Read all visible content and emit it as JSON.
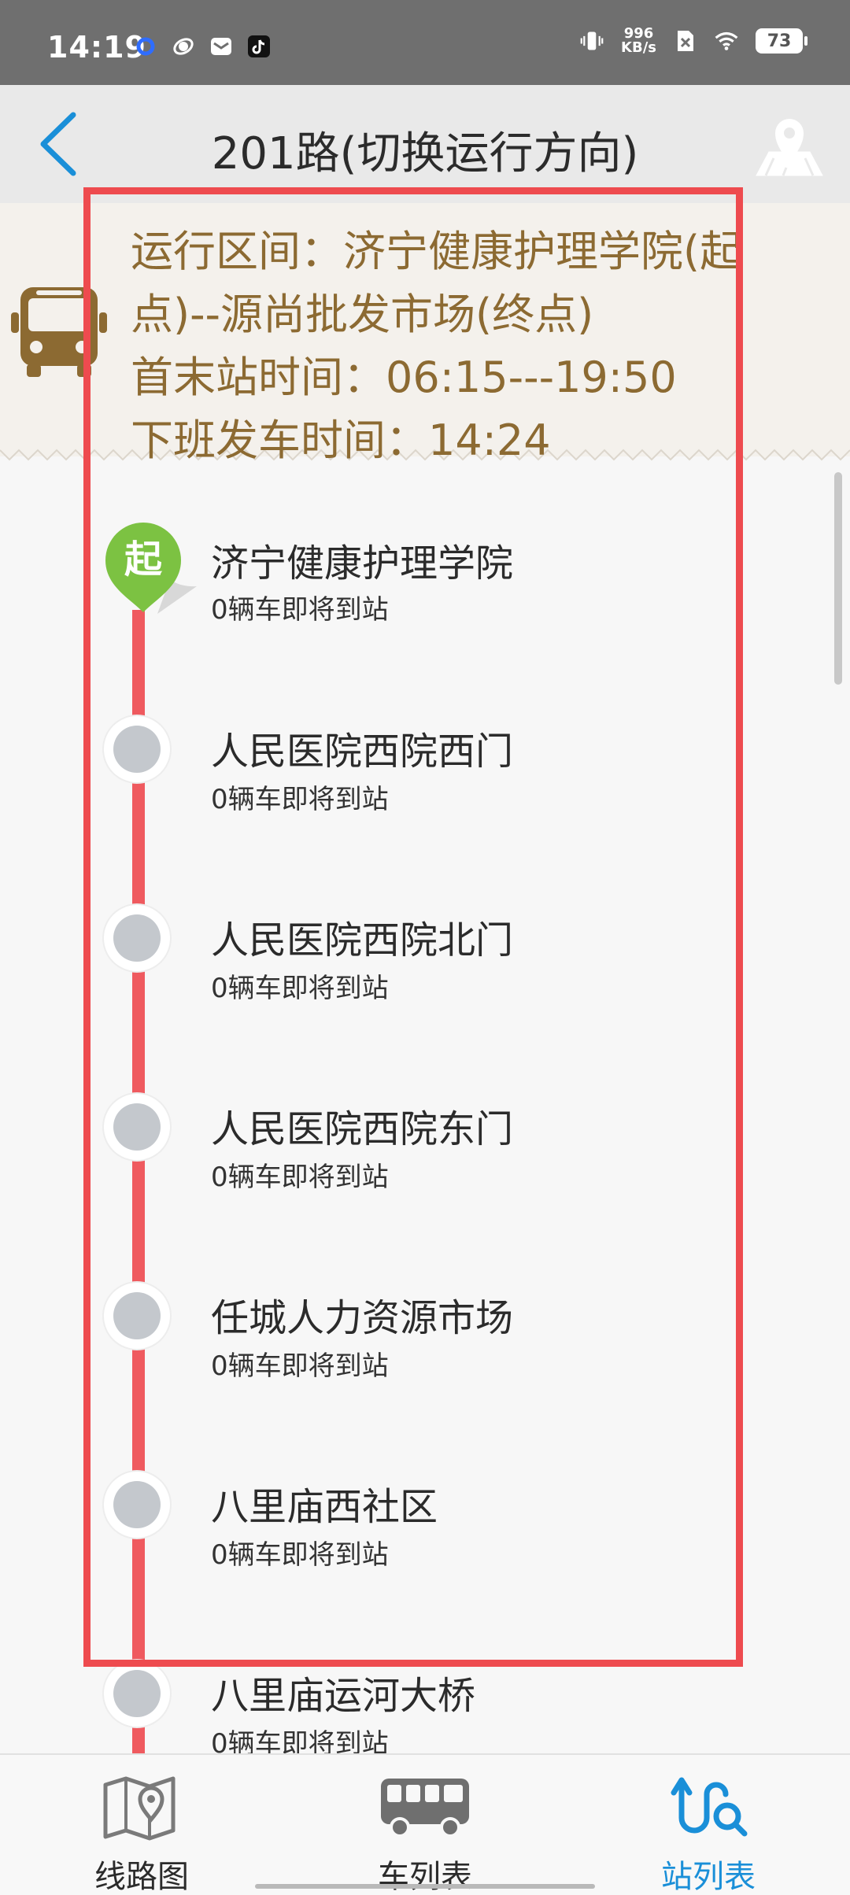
{
  "status_bar": {
    "time": "14:19",
    "speed_value": "996",
    "speed_unit": "KB/s",
    "battery": "73"
  },
  "header": {
    "title": "201路(切换运行方向)"
  },
  "info": {
    "line1": "运行区间：济宁健康护理学院(起",
    "line2": "点)--源尚批发市场(终点)",
    "line3": "首末站时间：06:15---19:50",
    "line4": "下班发车时间：14:24"
  },
  "start_marker_label": "起",
  "stations": [
    {
      "name": "济宁健康护理学院",
      "status": "0辆车即将到站"
    },
    {
      "name": "人民医院西院西门",
      "status": "0辆车即将到站"
    },
    {
      "name": "人民医院西院北门",
      "status": "0辆车即将到站"
    },
    {
      "name": "人民医院西院东门",
      "status": "0辆车即将到站"
    },
    {
      "name": "任城人力资源市场",
      "status": "0辆车即将到站"
    },
    {
      "name": "八里庙西社区",
      "status": "0辆车即将到站"
    },
    {
      "name": "八里庙运河大桥",
      "status": "0辆车即将到站"
    }
  ],
  "nav": {
    "map": "线路图",
    "buses": "车列表",
    "stations": "站列表"
  },
  "colors": {
    "accent_blue": "#1a8fd8",
    "route_red": "#ef5a5f",
    "info_brown": "#8c6a32",
    "start_green": "#7cc242"
  }
}
